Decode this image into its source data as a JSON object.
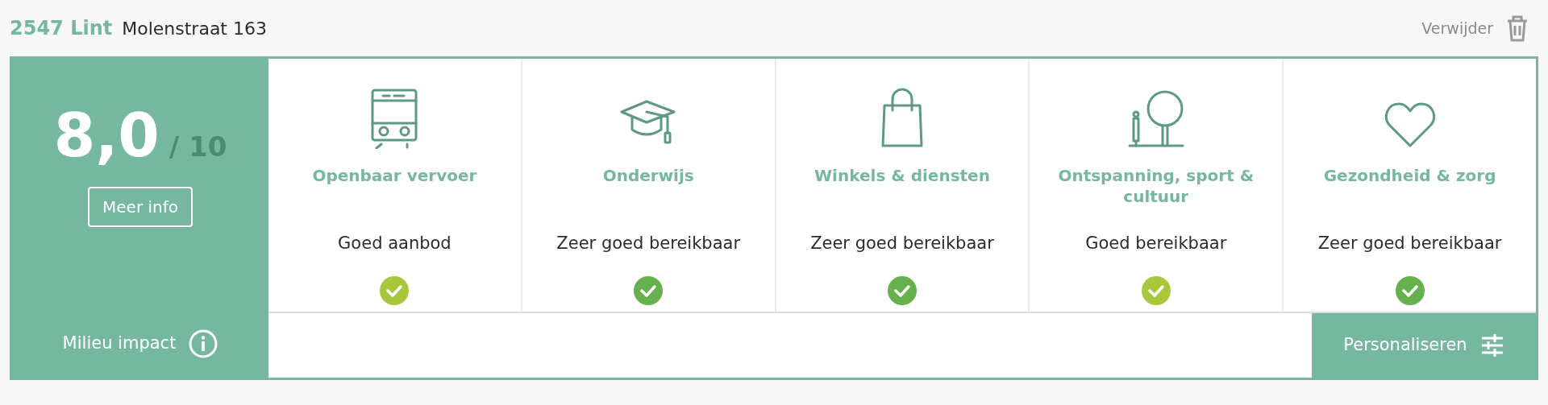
{
  "header": {
    "city": "2547 Lint",
    "street": "Molenstraat 163",
    "remove_label": "Verwijder"
  },
  "score": {
    "value": "8,0",
    "max": "/ 10",
    "button": "Meer info"
  },
  "categories": [
    {
      "title": "Openbaar vervoer",
      "rating": "Goed aanbod",
      "color": "#a8c73a"
    },
    {
      "title": "Onderwijs",
      "rating": "Zeer goed bereikbaar",
      "color": "#66b04e"
    },
    {
      "title": "Winkels & diensten",
      "rating": "Zeer goed bereikbaar",
      "color": "#66b04e"
    },
    {
      "title": "Ontspanning, sport & cultuur",
      "rating": "Goed bereikbaar",
      "color": "#a8c73a"
    },
    {
      "title": "Gezondheid & zorg",
      "rating": "Zeer goed bereikbaar",
      "color": "#66b04e"
    }
  ],
  "footer": {
    "impact_label": "Milieu impact",
    "personalize_button": "Personaliseren"
  }
}
